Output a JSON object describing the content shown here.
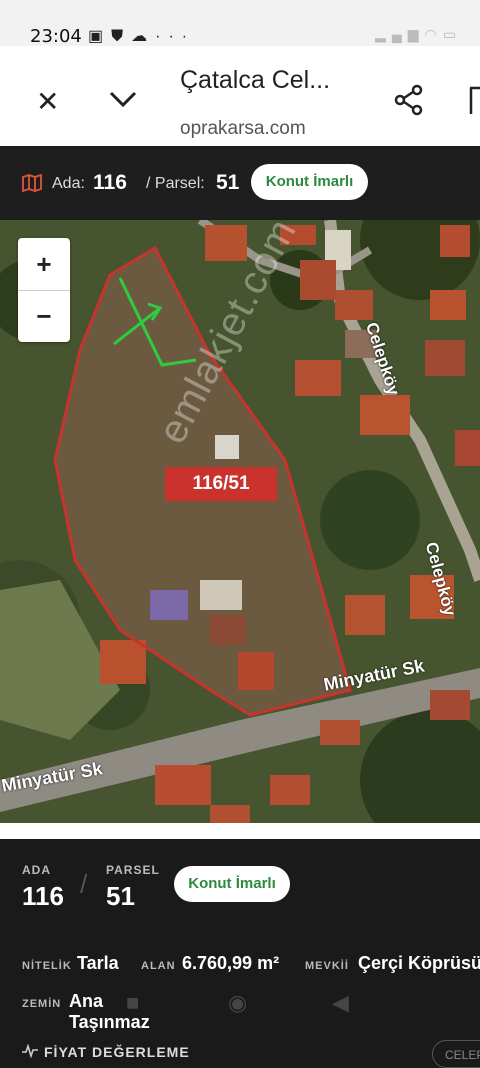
{
  "status_bar": {
    "time": "23:04",
    "icons": [
      "package-icon",
      "shield-icon",
      "cloud-icon",
      "more-icon"
    ],
    "right_icons": [
      "signal-icon",
      "wifi-icon",
      "battery-icon"
    ]
  },
  "browser": {
    "title": "Çatalca Cel...",
    "url": "oprakarsa.com",
    "icons": [
      "close-icon",
      "chevron-down-icon",
      "share-icon",
      "bookmark-icon"
    ]
  },
  "parcel_bar": {
    "ada_label": "Ada:",
    "ada_value": "116",
    "parsel_label": "/ Parsel:",
    "parsel_value": "51",
    "zoning_badge": "Konut İmarlı"
  },
  "map": {
    "zoom_in": "+",
    "zoom_out": "−",
    "parcel_label": "116/51",
    "streets": [
      "Minyatür Sk",
      "Minyatür Sk",
      "Celepköy",
      "Celepköy"
    ],
    "watermark": "emlakjet.com",
    "colors": {
      "parcel_outline": "#c9322d",
      "north_arrow": "#2ecc40"
    }
  },
  "info": {
    "ada_label": "ADA",
    "ada_value": "116",
    "separator": "/",
    "parsel_label": "PARSEL",
    "parsel_value": "51",
    "zoning_badge": "Konut İmarlı",
    "nitelik_label": "NİTELİK",
    "nitelik_value": "Tarla",
    "alan_label": "ALAN",
    "alan_value": "6.760,99 m²",
    "mevkii_label": "MEVKİİ",
    "mevkii_value": "Çerçi Köprüsü",
    "zemin_label": "ZEMİN",
    "zemin_value": "Ana Taşınmaz",
    "fiyat_label": "FİYAT DEĞERLEME",
    "chip_label": "CELEP"
  },
  "colors": {
    "accent_green": "#2b8a3e",
    "dark_bg": "#1a1a1a"
  }
}
